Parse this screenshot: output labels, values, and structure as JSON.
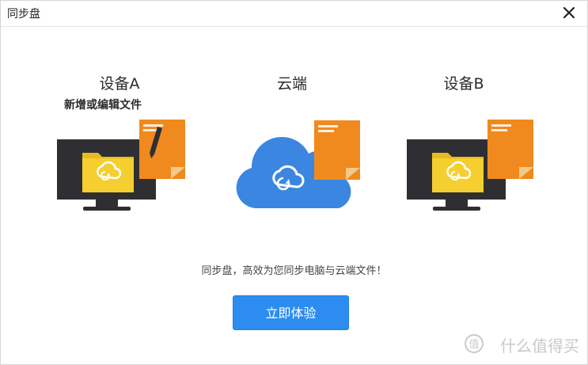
{
  "window": {
    "title": "同步盘",
    "close_label": "×"
  },
  "device_a": {
    "label": "设备A",
    "caption": "新增或编辑文件"
  },
  "cloud": {
    "label": "云端"
  },
  "device_b": {
    "label": "设备B"
  },
  "tagline": "同步盘，高效为您同步电脑与云端文件！",
  "cta": {
    "label": "立即体验"
  },
  "watermark": {
    "text": "什么值得买"
  },
  "colors": {
    "accent_blue": "#2d8cf0",
    "cloud_blue": "#3b86e0",
    "document_orange": "#f08a1e",
    "folder_yellow": "#f5cf2f",
    "monitor_dark": "#2f2f33"
  },
  "icons": {
    "close": "close-icon",
    "sync": "sync-icon",
    "cloud": "cloud-icon",
    "pencil": "pencil-icon"
  }
}
